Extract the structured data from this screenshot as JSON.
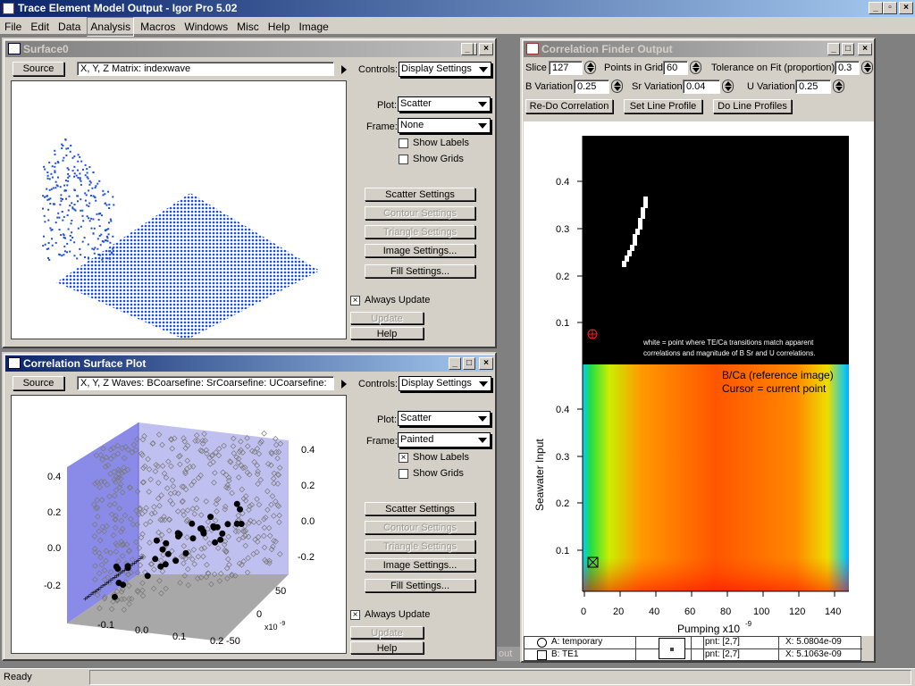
{
  "app": {
    "title": "Trace Element Model Output - Igor Pro 5.02"
  },
  "menu": [
    "File",
    "Edit",
    "Data",
    "Analysis",
    "Macros",
    "Windows",
    "Misc",
    "Help",
    "Image"
  ],
  "surface0": {
    "title": "Surface0",
    "source_button": "Source",
    "source_field": "X, Y, Z Matrix: indexwave",
    "controls_label": "Controls:",
    "controls_value": "Display Settings",
    "plot_label": "Plot:",
    "plot_value": "Scatter",
    "frame_label": "Frame:",
    "frame_value": "None",
    "show_labels": "Show Labels",
    "show_grids": "Show Grids",
    "scatter_settings": "Scatter Settings",
    "contour_settings": "Contour Settings",
    "triangle_settings": "Triangle Settings",
    "image_settings": "Image Settings...",
    "fill_settings": "Fill Settings...",
    "always_update": "Always Update",
    "update": "Update",
    "help": "Help"
  },
  "corr_surface": {
    "title": "Correlation Surface Plot",
    "source_button": "Source",
    "source_field": "X, Y, Z Waves: BCoarsefine: SrCoarsefine: UCoarsefine:",
    "controls_label": "Controls:",
    "controls_value": "Display Settings",
    "plot_label": "Plot:",
    "plot_value": "Scatter",
    "frame_label": "Frame:",
    "frame_value": "Painted",
    "show_labels": "Show Labels",
    "show_grids": "Show Grids",
    "scatter_settings": "Scatter Settings",
    "contour_settings": "Contour Settings",
    "triangle_settings": "Triangle Settings",
    "image_settings": "Image Settings...",
    "fill_settings": "Fill Settings...",
    "always_update": "Always Update",
    "update": "Update",
    "help": "Help",
    "axis_ticks_left": [
      "0.4",
      "0.2",
      "0.0",
      "-0.2"
    ],
    "axis_ticks_right": [
      "0.4",
      "0.2",
      "0.0",
      "-0.2"
    ],
    "axis_ticks_bottom": [
      "-0.1",
      "0.0",
      "0.1",
      "0.2"
    ],
    "axis_ticks_depth": [
      "50",
      "0",
      "-50"
    ],
    "axis_exp": "x10",
    "axis_exp_power": "-9"
  },
  "finder": {
    "title": "Correlation Finder Output",
    "slice_label": "Slice",
    "slice_value": "127",
    "points_label": "Points in Grid",
    "points_value": "60",
    "tolerance_label": "Tolerance on Fit (proportion)",
    "tolerance_value": "0.3",
    "b_label": "B Variation",
    "b_value": "0.25",
    "sr_label": "Sr Variation",
    "sr_value": "0.04",
    "u_label": "U Variation",
    "u_value": "0.25",
    "redo_button": "Re-Do Correlation",
    "set_line_button": "Set Line Profile",
    "do_line_button": "Do Line Profiles",
    "black_note_1": "white = point where TE/Ca transitions match apparent",
    "black_note_2": "correlations and magnitude of B Sr and U correlations.",
    "legend_1": "B/Ca (reference image)",
    "legend_2": "Cursor = current point",
    "y_ticks_top": [
      "0.4",
      "0.3",
      "0.2",
      "0.1"
    ],
    "y_ticks_bottom": [
      "0.4",
      "0.3",
      "0.2",
      "0.1"
    ],
    "x_ticks": [
      "0",
      "20",
      "40",
      "60",
      "80",
      "100",
      "120",
      "140"
    ],
    "y_axis_label": "Seawater Input",
    "x_axis_label": "Pumping x10",
    "x_axis_power": "-9",
    "cursor_a_label": "A: temporary",
    "cursor_b_label": "B: TE1",
    "cursor_a_pnt": "pnt: [2,7]",
    "cursor_b_pnt": "pnt: [2,7]",
    "cursor_a_x": "X: 5.0804e-09",
    "cursor_b_x": "X: 5.1063e-09"
  },
  "hidden_tab": "out",
  "status": {
    "text": "Ready"
  },
  "colors": {
    "title_active": "#0a246a",
    "title_gradient_end": "#a6caf0",
    "chrome": "#d4d0c8",
    "scatter_blue": "#1f4fd8"
  }
}
